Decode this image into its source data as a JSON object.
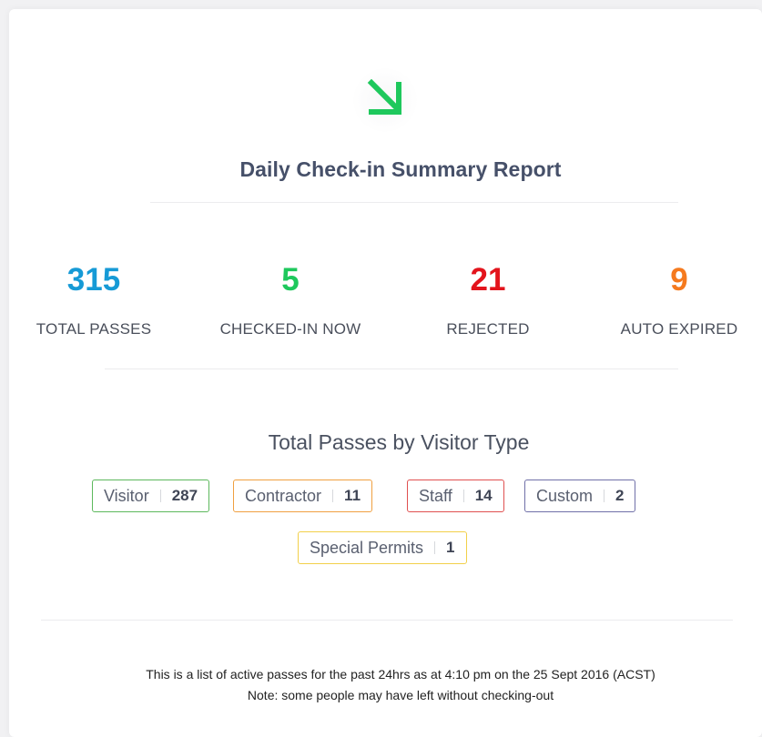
{
  "report": {
    "title": "Daily Check-in Summary Report",
    "icon": "arrow-down-right-icon",
    "icon_color": "#1ec85c"
  },
  "stats": [
    {
      "value": "315",
      "label": "TOTAL PASSES",
      "color": "#169ad6"
    },
    {
      "value": "5",
      "label": "CHECKED-IN NOW",
      "color": "#1ec85c"
    },
    {
      "value": "21",
      "label": "REJECTED",
      "color": "#e3141c"
    },
    {
      "value": "9",
      "label": "AUTO EXPIRED",
      "color": "#f57a1e"
    }
  ],
  "visitor_types": {
    "title": "Total Passes by Visitor Type",
    "badges": [
      {
        "label": "Visitor",
        "count": "287",
        "color": "#5cb85c"
      },
      {
        "label": "Contractor",
        "count": "11",
        "color": "#f0a040"
      },
      {
        "label": "Staff",
        "count": "14",
        "color": "#e05050"
      },
      {
        "label": "Custom",
        "count": "2",
        "color": "#7070a8"
      },
      {
        "label": "Special Permits",
        "count": "1",
        "color": "#f2d04a"
      }
    ]
  },
  "footer": {
    "line1": "This is a list of active passes for the past 24hrs as at 4:10 pm on the 25 Sept 2016 (ACST)",
    "line2": "Note: some people may have left without checking-out"
  }
}
